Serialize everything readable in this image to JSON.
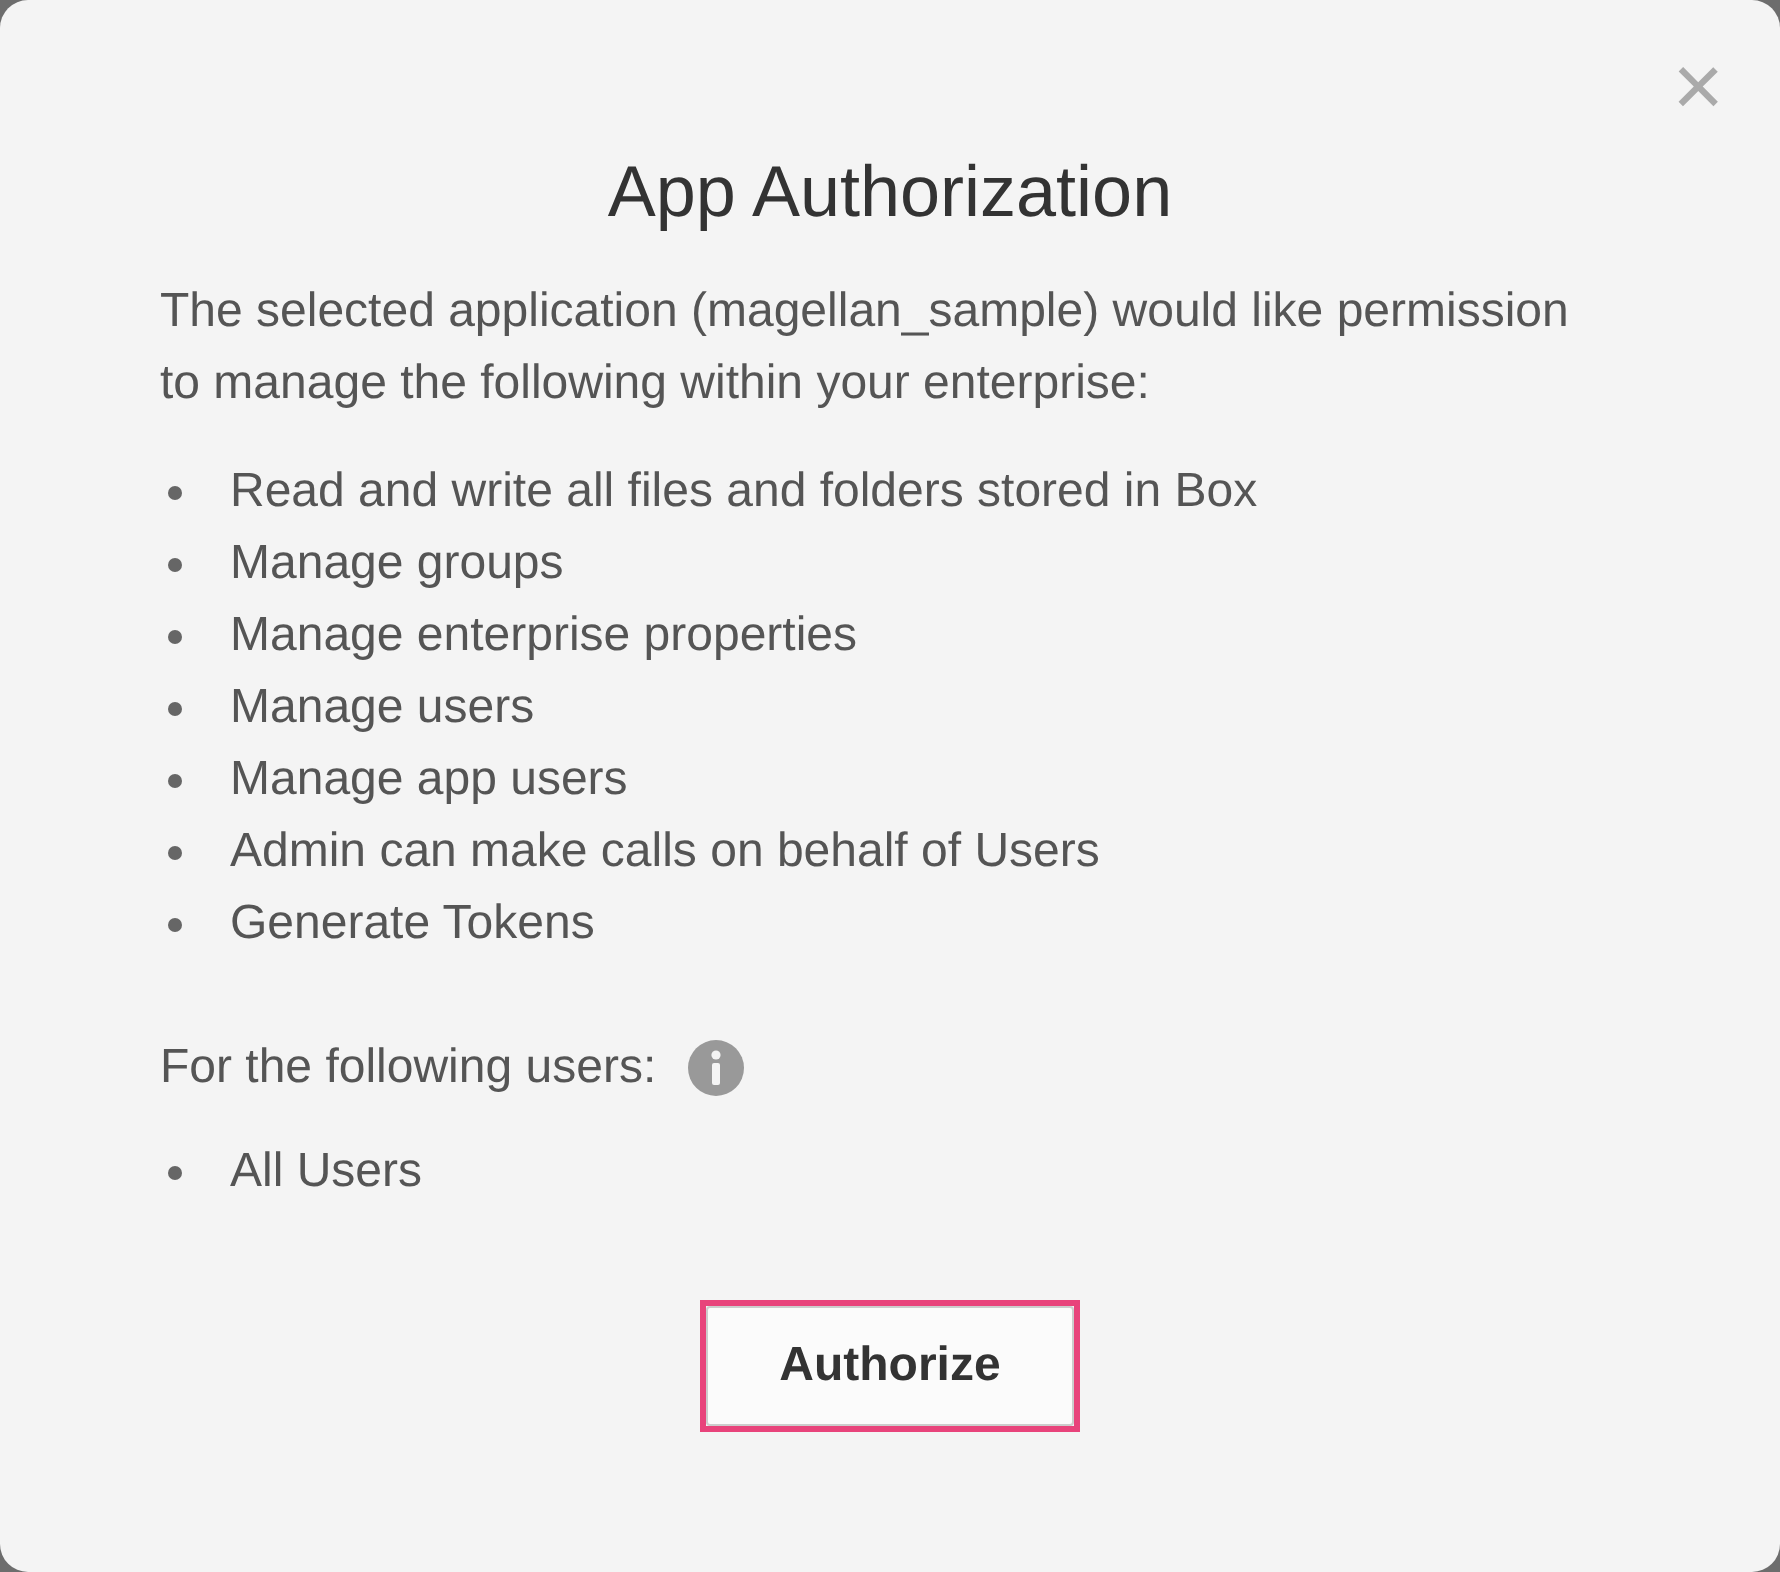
{
  "dialog": {
    "close": "×",
    "title": "App Authorization",
    "intro": "The selected application (magellan_sample) would like permission to manage the following within your enterprise:",
    "permissions": [
      "Read and write all files and folders stored in Box",
      "Manage groups",
      "Manage enterprise properties",
      "Manage users",
      "Manage app users",
      "Admin can make calls on behalf of Users",
      "Generate Tokens"
    ],
    "users_label": "For the following users:",
    "users": [
      "All Users"
    ],
    "button": {
      "label": "Authorize",
      "focused": true
    }
  }
}
